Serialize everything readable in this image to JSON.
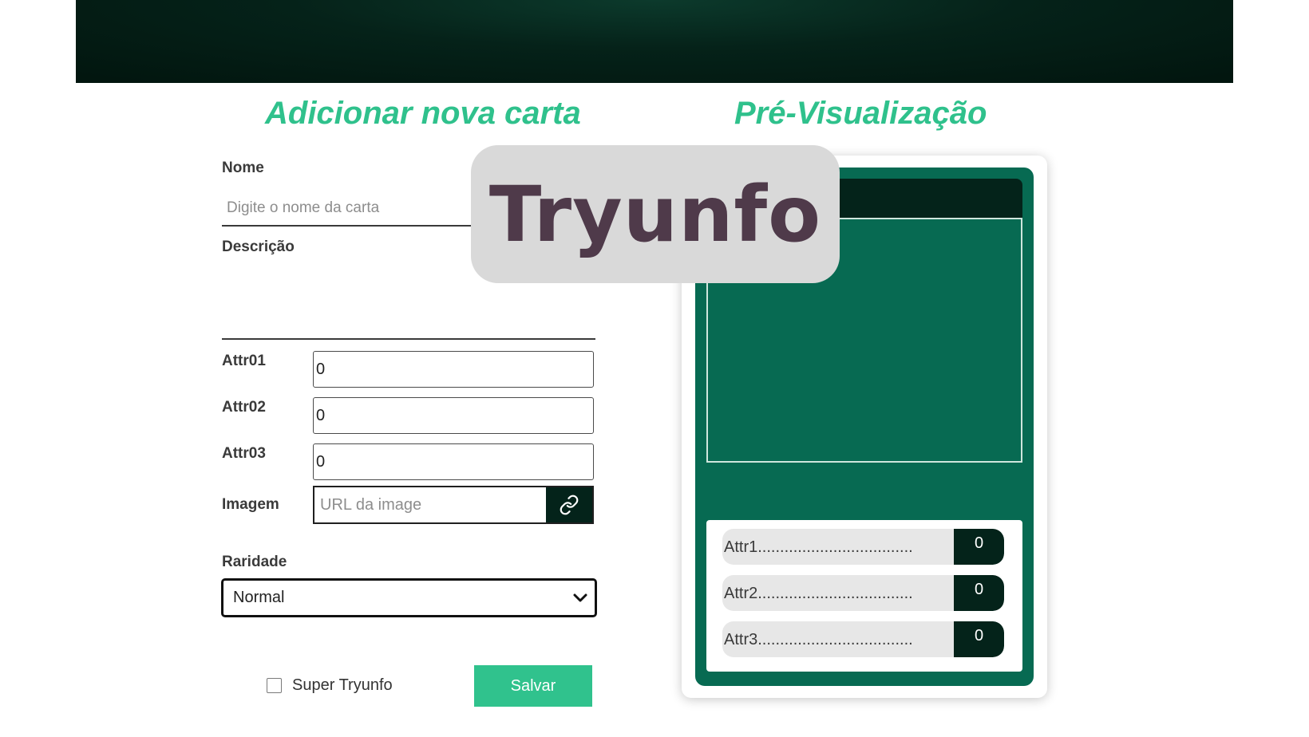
{
  "form": {
    "title": "Adicionar nova carta",
    "name_label": "Nome",
    "name_placeholder": "Digite o nome da carta",
    "name_value": "",
    "description_label": "Descrição",
    "description_value": "",
    "attrs": [
      {
        "label": "Attr01",
        "value": "0"
      },
      {
        "label": "Attr02",
        "value": "0"
      },
      {
        "label": "Attr03",
        "value": "0"
      }
    ],
    "image_label": "Imagem",
    "image_placeholder": "URL da image",
    "link_icon": "link-icon",
    "rarity_label": "Raridade",
    "rarity_value": "Normal",
    "super_label": "Super Tryunfo",
    "super_checked": false,
    "save_label": "Salvar"
  },
  "preview": {
    "title": "Pré-Visualização",
    "card_name": "",
    "attrs": [
      {
        "label": "Attr1...................................",
        "value": "0"
      },
      {
        "label": "Attr2...................................",
        "value": "0"
      },
      {
        "label": "Attr3...................................",
        "value": "0"
      }
    ]
  },
  "logo": {
    "text": "Tryunfo"
  },
  "colors": {
    "accent": "#30c28d",
    "card_green": "#076a52",
    "dark_green": "#04231a",
    "logo_text": "#4f3a4a"
  }
}
